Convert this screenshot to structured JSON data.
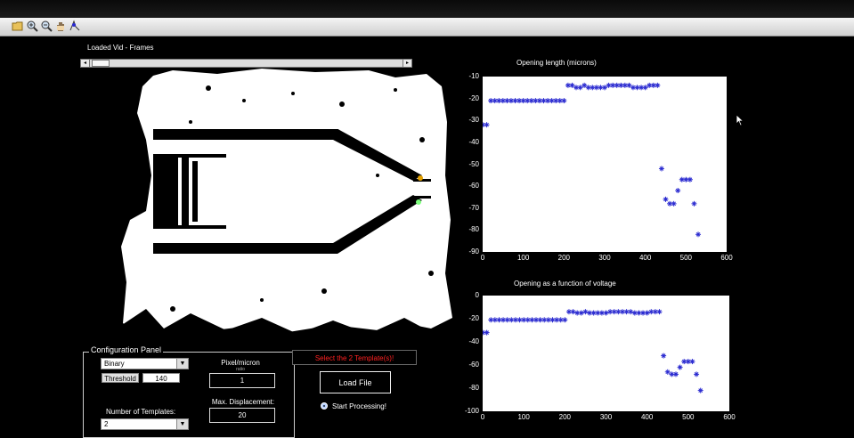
{
  "toolbar": {
    "icons": [
      "open-icon",
      "zoom-in-icon",
      "zoom-out-icon",
      "pan-icon",
      "data-cursor-icon"
    ]
  },
  "video": {
    "label": "Loaded Vid - Frames",
    "slider_left_arrow": "◂",
    "slider_right_arrow": "▸",
    "markers": {
      "top_color": "#e3a000",
      "bottom_color": "#7dff7d"
    }
  },
  "plot1": {
    "title": "Opening length (microns)",
    "xticks": [
      "0",
      "100",
      "200",
      "300",
      "400",
      "500",
      "600"
    ],
    "yticks": [
      "-10",
      "-20",
      "-30",
      "-40",
      "-50",
      "-60",
      "-70",
      "-80",
      "-90"
    ]
  },
  "plot2": {
    "title": "Opening as a function of voltage",
    "xticks": [
      "0",
      "100",
      "200",
      "300",
      "400",
      "500",
      "600"
    ],
    "yticks": [
      "0",
      "-20",
      "-40",
      "-60",
      "-80",
      "-100"
    ]
  },
  "config": {
    "title": "Configuration Panel",
    "mode_value": "Binary",
    "threshold_label": "Threshold",
    "threshold_value": "140",
    "num_templates_label": "Number of Templates:",
    "num_templates_value": "2",
    "pixel_micron_label": "Pixel/micron",
    "pixel_micron_sub": "ratio",
    "pixel_micron_value": "1",
    "max_disp_label": "Max. Displacement:",
    "max_disp_value": "20"
  },
  "actions": {
    "select_templates_msg": "Select the 2 Template(s)!",
    "load_file": "Load File",
    "start_processing": "Start Processing!"
  },
  "colors": {
    "marker": "#2a2ad0",
    "warning": "#ff2020"
  },
  "chart_data": [
    {
      "type": "scatter",
      "title": "Opening length (microns)",
      "xlabel": "",
      "ylabel": "",
      "xlim": [
        0,
        600
      ],
      "ylim": [
        -90,
        -10
      ],
      "grid": false,
      "series": [
        {
          "x": [
            0,
            10,
            20,
            30,
            40,
            50,
            60,
            70,
            80,
            90,
            100,
            110,
            120,
            130,
            140,
            150,
            160,
            170,
            180,
            190,
            200,
            210,
            220,
            230,
            240,
            250,
            260,
            270,
            280,
            290,
            300,
            310,
            320,
            330,
            340,
            350,
            360,
            370,
            380,
            390,
            400,
            410,
            420,
            430,
            440,
            450,
            460,
            470,
            480,
            490,
            500,
            510,
            520,
            530
          ],
          "y": [
            -32,
            -32,
            -21,
            -21,
            -21,
            -21,
            -21,
            -21,
            -21,
            -21,
            -21,
            -21,
            -21,
            -21,
            -21,
            -21,
            -21,
            -21,
            -21,
            -21,
            -21,
            -14,
            -14,
            -15,
            -15,
            -14,
            -15,
            -15,
            -15,
            -15,
            -15,
            -14,
            -14,
            -14,
            -14,
            -14,
            -14,
            -15,
            -15,
            -15,
            -15,
            -14,
            -14,
            -14,
            -52,
            -66,
            -68,
            -68,
            -62,
            -57,
            -57,
            -57,
            -68,
            -82
          ]
        }
      ]
    },
    {
      "type": "scatter",
      "title": "Opening as a function of voltage",
      "xlabel": "",
      "ylabel": "",
      "xlim": [
        0,
        600
      ],
      "ylim": [
        -100,
        0
      ],
      "grid": false,
      "series": [
        {
          "x": [
            0,
            10,
            20,
            30,
            40,
            50,
            60,
            70,
            80,
            90,
            100,
            110,
            120,
            130,
            140,
            150,
            160,
            170,
            180,
            190,
            200,
            210,
            220,
            230,
            240,
            250,
            260,
            270,
            280,
            290,
            300,
            310,
            320,
            330,
            340,
            350,
            360,
            370,
            380,
            390,
            400,
            410,
            420,
            430,
            440,
            450,
            460,
            470,
            480,
            490,
            500,
            510,
            520,
            530
          ],
          "y": [
            -32,
            -32,
            -21,
            -21,
            -21,
            -21,
            -21,
            -21,
            -21,
            -21,
            -21,
            -21,
            -21,
            -21,
            -21,
            -21,
            -21,
            -21,
            -21,
            -21,
            -21,
            -14,
            -14,
            -15,
            -15,
            -14,
            -15,
            -15,
            -15,
            -15,
            -15,
            -14,
            -14,
            -14,
            -14,
            -14,
            -14,
            -15,
            -15,
            -15,
            -15,
            -14,
            -14,
            -14,
            -52,
            -66,
            -68,
            -68,
            -62,
            -57,
            -57,
            -57,
            -68,
            -82
          ]
        }
      ]
    }
  ]
}
